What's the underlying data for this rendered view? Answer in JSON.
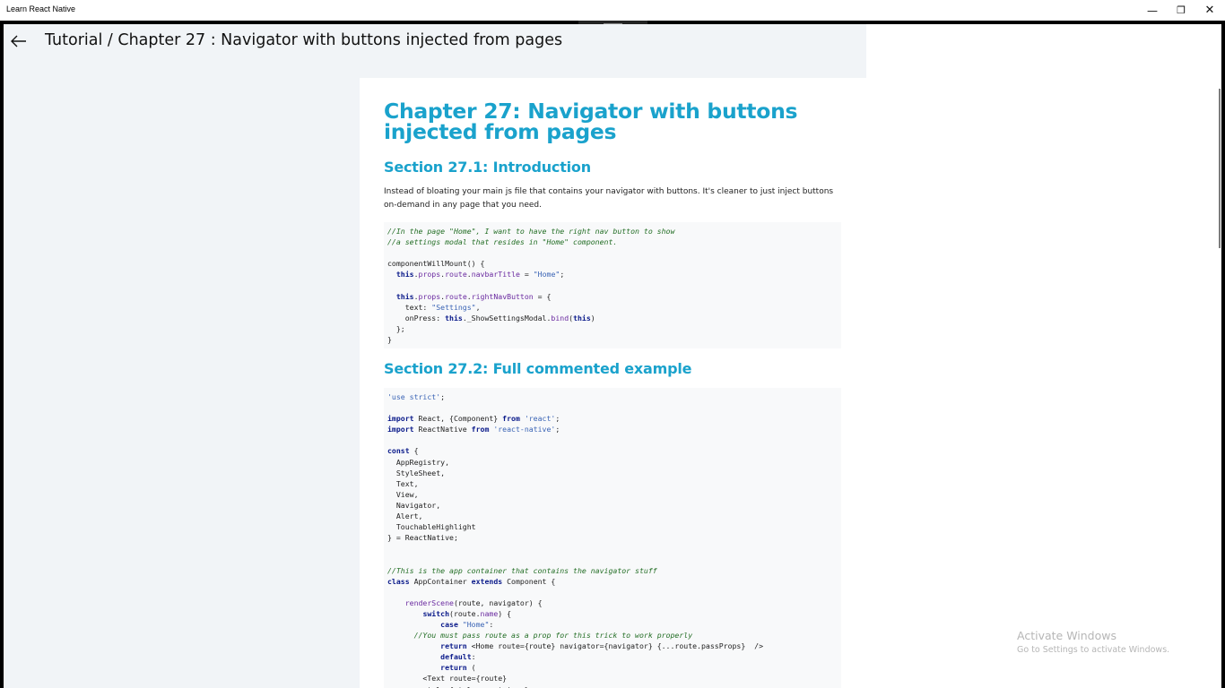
{
  "window": {
    "app_title": "Learn React Native",
    "minimize_glyph": "—",
    "maximize_glyph": "❐",
    "close_glyph": "✕"
  },
  "header": {
    "title": "Tutorial / Chapter 27 :  Navigator with buttons injected from pages",
    "back_icon": "arrow-left-icon"
  },
  "article": {
    "chapter_title": "Chapter 27: Navigator with buttons injected from pages",
    "sections": [
      {
        "heading": "Section 27.1: Introduction",
        "paragraph": "Instead of bloating your main js file that contains your navigator with buttons. It's cleaner to just inject buttons on-demand in any page that you need.",
        "code": [
          [
            {
              "t": "cm",
              "v": "//In the page \"Home\", I want to have the right nav button to show"
            }
          ],
          [
            {
              "t": "cm",
              "v": "//a settings modal that resides in \"Home\" component."
            }
          ],
          [],
          [
            {
              "t": "",
              "v": "componentWillMount() {"
            }
          ],
          [
            {
              "t": "",
              "v": "  "
            },
            {
              "t": "kw",
              "v": "this"
            },
            {
              "t": "",
              "v": "."
            },
            {
              "t": "nm",
              "v": "props"
            },
            {
              "t": "",
              "v": "."
            },
            {
              "t": "nm",
              "v": "route"
            },
            {
              "t": "",
              "v": "."
            },
            {
              "t": "nm",
              "v": "navbarTitle"
            },
            {
              "t": "",
              "v": " = "
            },
            {
              "t": "st",
              "v": "\"Home\""
            },
            {
              "t": "",
              "v": ";"
            }
          ],
          [],
          [
            {
              "t": "",
              "v": "  "
            },
            {
              "t": "kw",
              "v": "this"
            },
            {
              "t": "",
              "v": "."
            },
            {
              "t": "nm",
              "v": "props"
            },
            {
              "t": "",
              "v": "."
            },
            {
              "t": "nm",
              "v": "route"
            },
            {
              "t": "",
              "v": "."
            },
            {
              "t": "nm",
              "v": "rightNavButton"
            },
            {
              "t": "",
              "v": " = {"
            }
          ],
          [
            {
              "t": "",
              "v": "    text: "
            },
            {
              "t": "st",
              "v": "\"Settings\""
            },
            {
              "t": "",
              "v": ","
            }
          ],
          [
            {
              "t": "",
              "v": "    onPress: "
            },
            {
              "t": "kw",
              "v": "this"
            },
            {
              "t": "",
              "v": "._ShowSettingsModal."
            },
            {
              "t": "nm",
              "v": "bind"
            },
            {
              "t": "",
              "v": "("
            },
            {
              "t": "kw",
              "v": "this"
            },
            {
              "t": "",
              "v": ")"
            }
          ],
          [
            {
              "t": "",
              "v": "  };"
            }
          ],
          [
            {
              "t": "",
              "v": "}"
            }
          ]
        ]
      },
      {
        "heading": "Section 27.2: Full commented example",
        "code": [
          [
            {
              "t": "st",
              "v": "'use strict'"
            },
            {
              "t": "",
              "v": ";"
            }
          ],
          [],
          [
            {
              "t": "kw",
              "v": "import"
            },
            {
              "t": "",
              "v": " React, {Component} "
            },
            {
              "t": "kw",
              "v": "from"
            },
            {
              "t": "",
              "v": " "
            },
            {
              "t": "st",
              "v": "'react'"
            },
            {
              "t": "",
              "v": ";"
            }
          ],
          [
            {
              "t": "kw",
              "v": "import"
            },
            {
              "t": "",
              "v": " ReactNative "
            },
            {
              "t": "kw",
              "v": "from"
            },
            {
              "t": "",
              "v": " "
            },
            {
              "t": "st",
              "v": "'react-native'"
            },
            {
              "t": "",
              "v": ";"
            }
          ],
          [],
          [
            {
              "t": "kw",
              "v": "const"
            },
            {
              "t": "",
              "v": " {"
            }
          ],
          [
            {
              "t": "",
              "v": "  AppRegistry,"
            }
          ],
          [
            {
              "t": "",
              "v": "  StyleSheet,"
            }
          ],
          [
            {
              "t": "",
              "v": "  Text,"
            }
          ],
          [
            {
              "t": "",
              "v": "  View,"
            }
          ],
          [
            {
              "t": "",
              "v": "  Navigator,"
            }
          ],
          [
            {
              "t": "",
              "v": "  Alert,"
            }
          ],
          [
            {
              "t": "",
              "v": "  TouchableHighlight"
            }
          ],
          [
            {
              "t": "",
              "v": "} = ReactNative;"
            }
          ],
          [],
          [],
          [
            {
              "t": "cm",
              "v": "//This is the app container that contains the navigator stuff"
            }
          ],
          [
            {
              "t": "kw",
              "v": "class"
            },
            {
              "t": "",
              "v": " AppContainer "
            },
            {
              "t": "kw",
              "v": "extends"
            },
            {
              "t": "",
              "v": " Component {"
            }
          ],
          [],
          [
            {
              "t": "",
              "v": "    "
            },
            {
              "t": "nm",
              "v": "renderScene"
            },
            {
              "t": "",
              "v": "(route, navigator) {"
            }
          ],
          [
            {
              "t": "",
              "v": "        "
            },
            {
              "t": "kw",
              "v": "switch"
            },
            {
              "t": "",
              "v": "(route."
            },
            {
              "t": "nm",
              "v": "name"
            },
            {
              "t": "",
              "v": ") {"
            }
          ],
          [
            {
              "t": "",
              "v": "            "
            },
            {
              "t": "kw",
              "v": "case"
            },
            {
              "t": "",
              "v": " "
            },
            {
              "t": "st",
              "v": "\"Home\""
            },
            {
              "t": "",
              "v": ":"
            }
          ],
          [
            {
              "t": "",
              "v": "      "
            },
            {
              "t": "cm",
              "v": "//You must pass route as a prop for this trick to work properly"
            }
          ],
          [
            {
              "t": "",
              "v": "            "
            },
            {
              "t": "kw",
              "v": "return"
            },
            {
              "t": "",
              "v": " <Home route={route} navigator={navigator} {...route.passProps}  />"
            }
          ],
          [
            {
              "t": "",
              "v": "            "
            },
            {
              "t": "kw",
              "v": "default"
            },
            {
              "t": "",
              "v": ":"
            }
          ],
          [
            {
              "t": "",
              "v": "            "
            },
            {
              "t": "kw",
              "v": "return"
            },
            {
              "t": "",
              "v": " ("
            }
          ],
          [
            {
              "t": "",
              "v": "        <Text route={route}"
            }
          ],
          [
            {
              "t": "",
              "v": "        style={styles.container}>"
            }
          ]
        ]
      }
    ]
  },
  "watermark": {
    "line1": "Activate Windows",
    "line2": "Go to Settings to activate Windows."
  }
}
